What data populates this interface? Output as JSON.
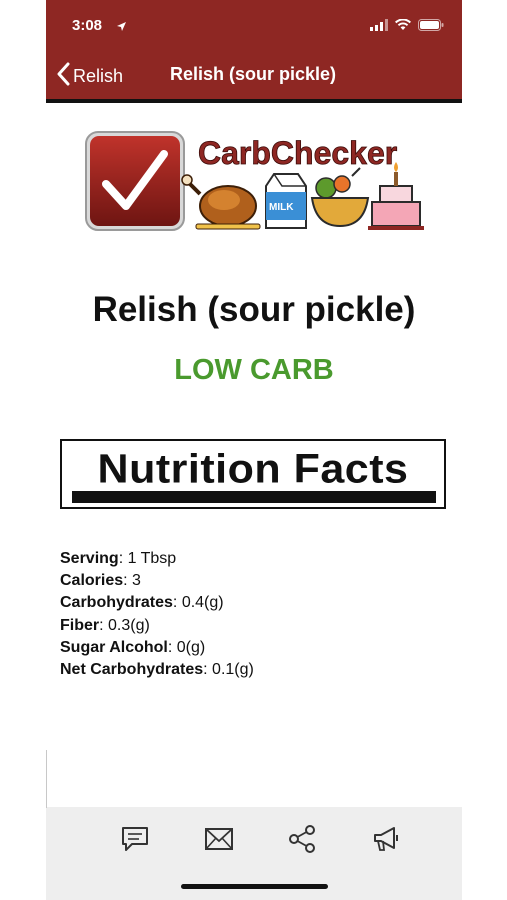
{
  "status_bar": {
    "time": "3:08"
  },
  "nav": {
    "back_label": "Relish",
    "title": "Relish (sour pickle)"
  },
  "logo": {
    "brand": "CarbChecker",
    "milk_label": "MILK"
  },
  "food": {
    "name": "Relish (sour pickle)",
    "carb_level": "LOW CARB"
  },
  "nutrition_header": "Nutrition Facts",
  "nutrition": [
    {
      "label": "Serving",
      "value": "1 Tbsp"
    },
    {
      "label": "Calories",
      "value": "3"
    },
    {
      "label": "Carbohydrates",
      "value": "0.4(g)"
    },
    {
      "label": "Fiber",
      "value": "0.3(g)"
    },
    {
      "label": "Sugar Alcohol",
      "value": "0(g)"
    },
    {
      "label": "Net Carbohydrates",
      "value": "0.1(g)"
    }
  ],
  "toolbar": {
    "icons": [
      "comment-icon",
      "mail-icon",
      "share-icon",
      "megaphone-icon"
    ]
  },
  "colors": {
    "header": "#8e2723",
    "low_carb": "#4a9a2e",
    "toolbar": "#eeeeee"
  }
}
